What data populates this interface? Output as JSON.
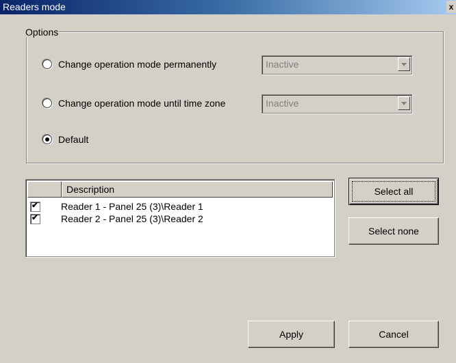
{
  "window": {
    "title": "Readers mode",
    "close_glyph": "x"
  },
  "options": {
    "legend": "Options",
    "radios": [
      {
        "label": "Change operation mode  permanently",
        "checked": false,
        "combo_value": "Inactive"
      },
      {
        "label": "Change operation mode until time zone",
        "checked": false,
        "combo_value": "Inactive"
      },
      {
        "label": "Default",
        "checked": true
      }
    ]
  },
  "readers_list": {
    "columns": [
      "",
      "Description"
    ],
    "rows": [
      {
        "checked": true,
        "description": "Reader 1 - Panel 25 (3)\\Reader 1"
      },
      {
        "checked": true,
        "description": "Reader 2 - Panel 25 (3)\\Reader 2"
      }
    ]
  },
  "buttons": {
    "select_all": "Select all",
    "select_none": "Select none",
    "apply": "Apply",
    "cancel": "Cancel"
  },
  "icons": {
    "checkmark": "✔",
    "dropdown": "chevron-down-icon"
  }
}
